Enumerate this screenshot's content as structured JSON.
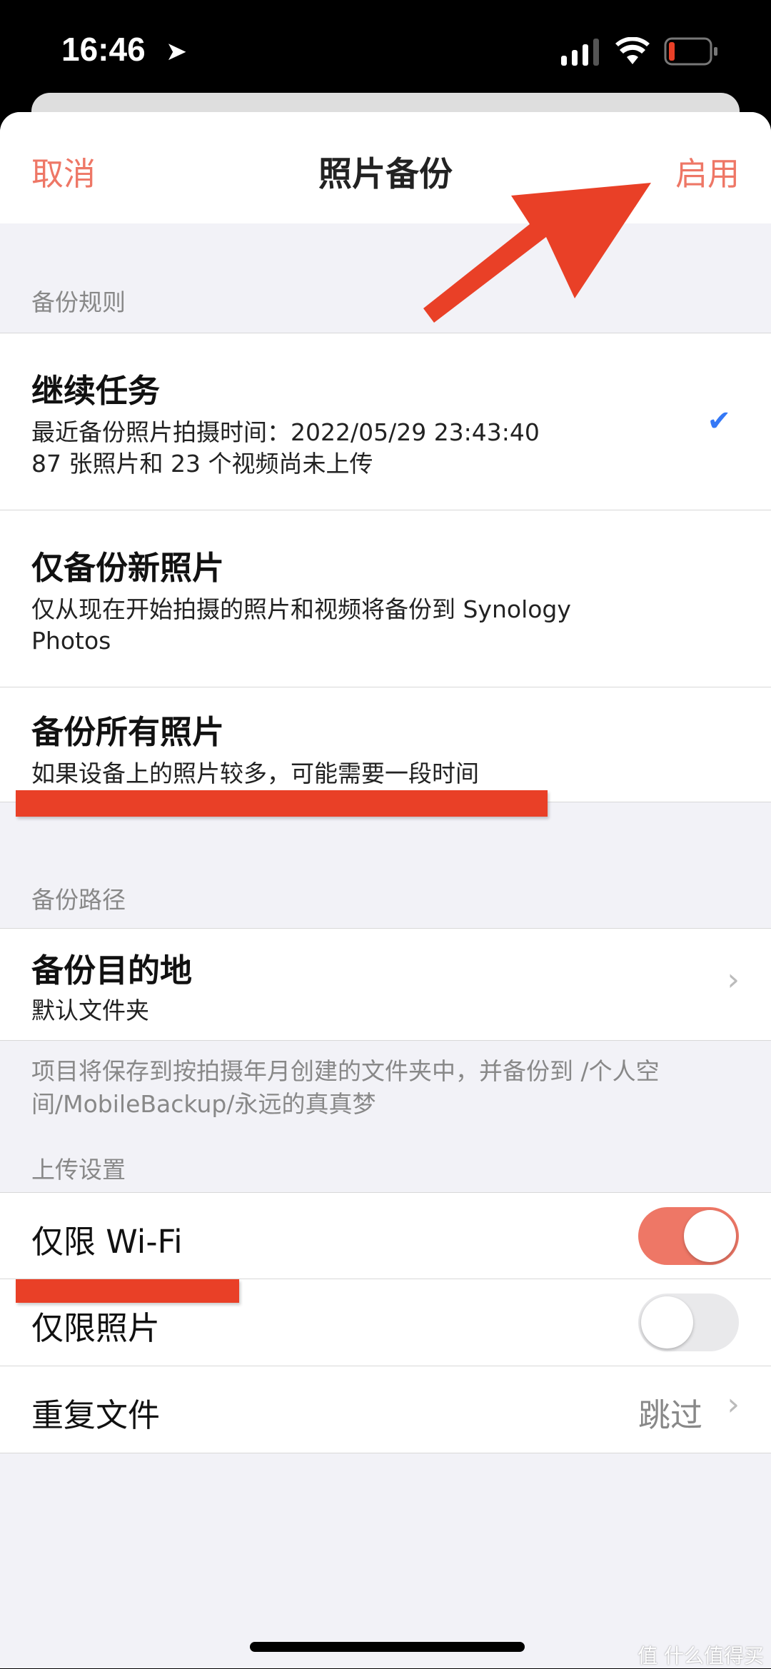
{
  "status_bar": {
    "time": "16:46",
    "icons": [
      "location-arrow-icon",
      "signal-icon",
      "wifi-icon",
      "battery-low-icon"
    ]
  },
  "nav": {
    "cancel": "取消",
    "title": "照片备份",
    "enable": "启用"
  },
  "backup_rules": {
    "header": "备份规则",
    "options": [
      {
        "title": "继续任务",
        "subtitle": "最近备份照片拍摄时间：2022/05/29 23:43:40",
        "subtitle2": "87 张照片和 23 个视频尚未上传",
        "selected": true
      },
      {
        "title": "仅备份新照片",
        "subtitle": "仅从现在开始拍摄的照片和视频将备份到 Synology Photos",
        "selected": false
      },
      {
        "title": "备份所有照片",
        "subtitle": "如果设备上的照片较多，可能需要一段时间",
        "selected": false
      }
    ]
  },
  "backup_path": {
    "header": "备份路径",
    "destination_title": "备份目的地",
    "destination_value": "默认文件夹",
    "footer": "项目将保存到按拍摄年月创建的文件夹中，并备份到 /个人空间/MobileBackup/永远的真真梦"
  },
  "upload": {
    "header": "上传设置",
    "wifi_only": {
      "label": "仅限 Wi-Fi",
      "on": true
    },
    "photos_only": {
      "label": "仅限照片",
      "on": false
    },
    "duplicates": {
      "label": "重复文件",
      "value": "跳过"
    }
  },
  "colors": {
    "accent": "#ee7766",
    "annotation": "#e94027",
    "check": "#3478f6"
  },
  "watermark": "值 什么值得买"
}
